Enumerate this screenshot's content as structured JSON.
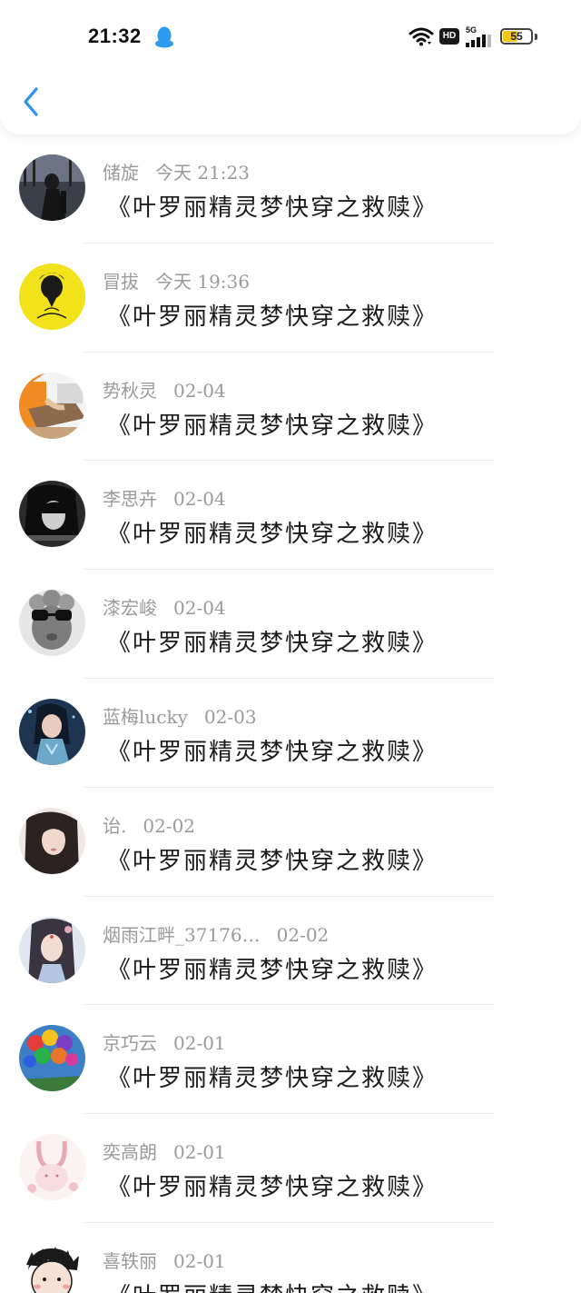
{
  "status_bar": {
    "time": "21:32",
    "network_label": "HD",
    "signal_label": "5G",
    "battery_percent": "55",
    "battery_level": 0.55,
    "icons": [
      "qq-penguin-icon",
      "wifi-icon",
      "hd-icon",
      "signal-5g-icon",
      "battery-icon"
    ]
  },
  "nav": {
    "back_icon": "chevron-left-icon",
    "accent_color": "#2d8ff0"
  },
  "comments": [
    {
      "name": "储旋",
      "time": "今天 21:23",
      "content": "《叶罗丽精灵梦快穿之救赎》"
    },
    {
      "name": "冒拔",
      "time": "今天 19:36",
      "content": "《叶罗丽精灵梦快穿之救赎》"
    },
    {
      "name": "势秋灵",
      "time": "02-04",
      "content": "《叶罗丽精灵梦快穿之救赎》"
    },
    {
      "name": "李思卉",
      "time": "02-04",
      "content": "《叶罗丽精灵梦快穿之救赎》"
    },
    {
      "name": "漆宏峻",
      "time": "02-04",
      "content": "《叶罗丽精灵梦快穿之救赎》"
    },
    {
      "name": "蓝梅lucky",
      "time": "02-03",
      "content": "《叶罗丽精灵梦快穿之救赎》"
    },
    {
      "name": "诒.",
      "time": "02-02",
      "content": "《叶罗丽精灵梦快穿之救赎》"
    },
    {
      "name": "烟雨江畔_37176…",
      "time": "02-02",
      "content": "《叶罗丽精灵梦快穿之救赎》"
    },
    {
      "name": "京巧云",
      "time": "02-01",
      "content": "《叶罗丽精灵梦快穿之救赎》"
    },
    {
      "name": "奕高朗",
      "time": "02-01",
      "content": "《叶罗丽精灵梦快穿之救赎》"
    },
    {
      "name": "喜轶丽",
      "time": "02-01",
      "content": "《叶罗丽精灵梦快穿之救赎》"
    }
  ]
}
